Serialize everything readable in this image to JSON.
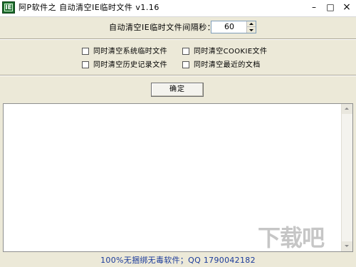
{
  "window": {
    "title": "阿P软件之 自动清空IE临时文件 v1.16",
    "icon_text": "IE",
    "min_glyph": "–",
    "max_glyph": "□",
    "close_glyph": "×"
  },
  "interval": {
    "label": "自动清空IE临时文件间隔秒：",
    "value": "60"
  },
  "options": [
    {
      "label": "同时清空系统临时文件",
      "checked": false
    },
    {
      "label": "同时清空COOKIE文件",
      "checked": false
    },
    {
      "label": "同时清空历史记录文件",
      "checked": false
    },
    {
      "label": "同时清空最近的文档",
      "checked": false
    }
  ],
  "ok_button": {
    "label": "确定"
  },
  "log": {
    "text": ""
  },
  "footer": {
    "text": "100%无捆绑无毒软件；QQ 1790042182"
  },
  "watermark": {
    "text": "下载吧"
  }
}
